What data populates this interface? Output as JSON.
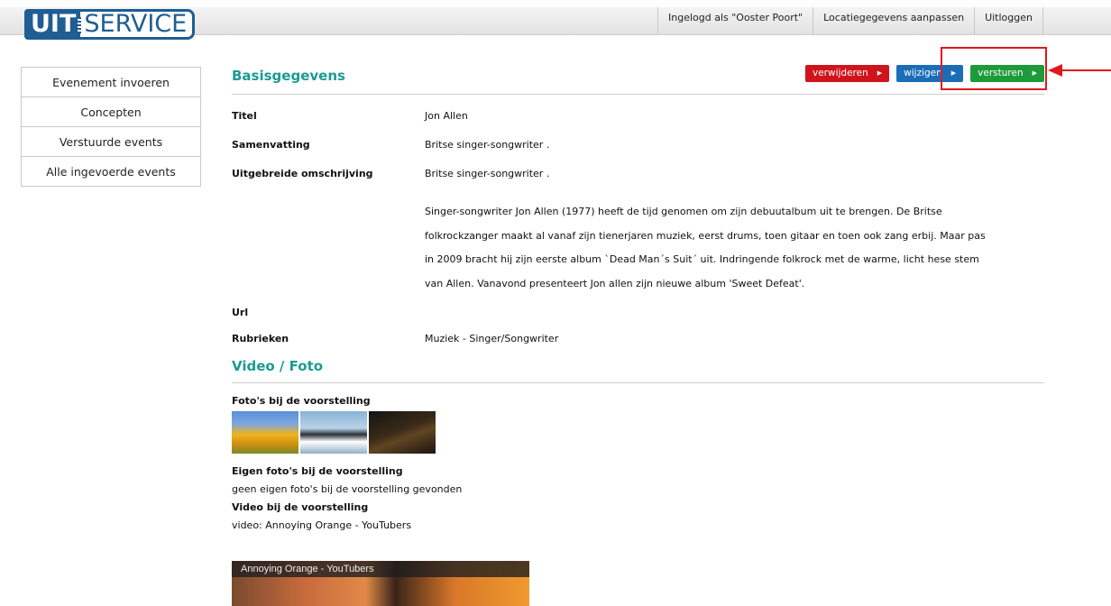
{
  "header": {
    "logo_left": "UIT",
    "logo_right": "SERVICE",
    "nav": [
      "Ingelogd als \"Ooster Poort\"",
      "Locatiegegevens aanpassen",
      "Uitloggen"
    ]
  },
  "sidebar": {
    "items": [
      "Evenement invoeren",
      "Concepten",
      "Verstuurde events",
      "Alle ingevoerde events"
    ]
  },
  "basis": {
    "title": "Basisgegevens",
    "buttons": {
      "delete": "verwijderen",
      "edit": "wijzigen",
      "send": "versturen"
    },
    "fields": {
      "titel_label": "Titel",
      "titel_value": "Jon Allen",
      "samenvatting_label": "Samenvatting",
      "samenvatting_value": "Britse singer-songwriter .",
      "omschrijving_label": "Uitgebreide omschrijving",
      "omschrijving_value": "Britse singer-songwriter .",
      "omschrijving_lines": [
        "Singer-songwriter Jon Allen (1977) heeft de tijd genomen om zijn debuutalbum uit te brengen. De Britse",
        "folkrockzanger maakt al vanaf zijn tienerjaren muziek, eerst drums, toen gitaar en toen ook zang erbij. Maar pas",
        "in 2009 bracht hij zijn eerste album `Dead Man´s Suit´ uit. Indringende folkrock met de warme, licht hese stem",
        "van Allen. Vanavond presenteert Jon allen zijn nieuwe album 'Sweet Defeat'."
      ],
      "url_label": "Url",
      "url_value": "",
      "rubrieken_label": "Rubrieken",
      "rubrieken_value": "Muziek - Singer/Songwriter"
    }
  },
  "media": {
    "title": "Video / Foto",
    "fotos_label": "Foto's bij de voorstelling",
    "eigen_label": "Eigen foto's bij de voorstelling",
    "eigen_empty": "geen eigen foto's bij de voorstelling gevonden",
    "video_label": "Video bij de voorstelling",
    "video_line": "video: Annoying Orange - YouTubers",
    "video_title": "Annoying Orange - YouTubers"
  },
  "colors": {
    "accent_teal": "#1b9a95",
    "delete_red": "#d0141c",
    "edit_blue": "#1b6db8",
    "send_green": "#1d9a3a",
    "annotation_red": "#e0181e"
  }
}
